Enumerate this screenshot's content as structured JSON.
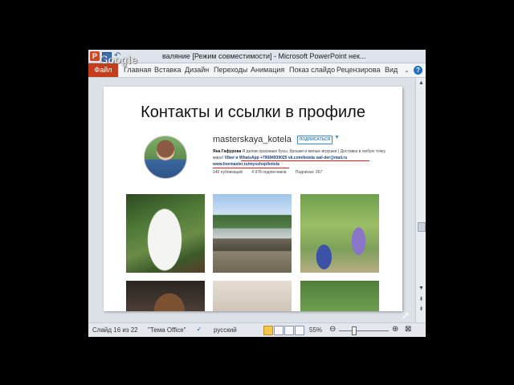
{
  "window": {
    "title": "валяние [Режим совместимости] - Microsoft PowerPoint нек...",
    "app_icon": "P",
    "badge": "Google"
  },
  "ribbon": {
    "file_tab": "Файл",
    "tabs": [
      "Главная",
      "Вставка",
      "Дизайн",
      "Переходы",
      "Анимация",
      "Показ слайдо",
      "Рецензирова",
      "Вид"
    ],
    "collapse_icon": "chevron-up-icon",
    "help_label": "?"
  },
  "slide": {
    "title": "Контакты и ссылки в профиле",
    "profile": {
      "username": "masterskaya_kotela",
      "follow_label": "ПОДПИСАТЬСЯ",
      "bio_name": "Яна Гафурова",
      "bio_text": "Я делаю красивые бусы, брошки и милые игрушки:) Доставка в любую точку мира!",
      "bio_contacts": "Viber и WhatsApp +79084939025",
      "bio_vk": "vk.com/kotela",
      "bio_email": "sail-der@mail.ru",
      "bio_url": "www.livemaster.ru/mysshop/kotela",
      "stats": [
        "140 публикаций",
        "4 978 подписчиков",
        "Подписки: 267"
      ]
    },
    "photos": [
      "bunny-toy",
      "lake-cows",
      "girls-garden",
      "woman-portrait",
      "light-interior",
      "green-garden"
    ]
  },
  "status": {
    "slide_info": "Слайд 16 из 22",
    "theme": "\"Тема Office\"",
    "language": "русский",
    "zoom": "55%",
    "zoom_fraction": 0.3
  },
  "colors": {
    "file_tab": "#c43e1c",
    "underline": "#e0201b",
    "follow": "#3b8ad2"
  }
}
